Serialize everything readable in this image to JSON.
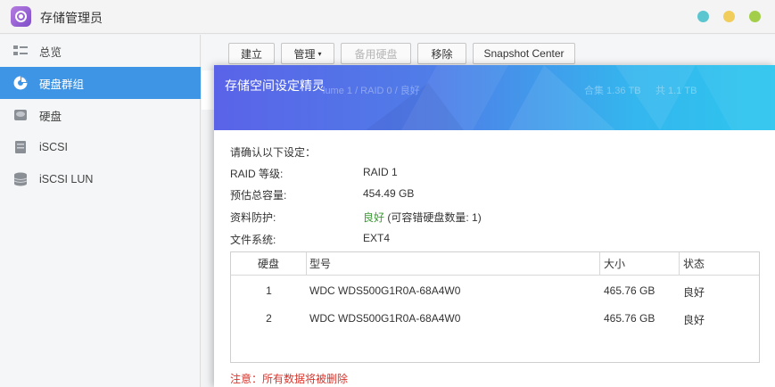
{
  "app": {
    "title": "存储管理员",
    "window_buttons": [
      {
        "name": "close",
        "color": "#5bc6cf"
      },
      {
        "name": "minimize",
        "color": "#f1cd5b"
      },
      {
        "name": "maximize",
        "color": "#a3ce4a"
      }
    ]
  },
  "sidebar": {
    "items": [
      {
        "label": "总览",
        "icon": "overview-icon"
      },
      {
        "label": "硬盘群组",
        "icon": "disk-group-icon",
        "active": true
      },
      {
        "label": "硬盘",
        "icon": "disk-icon"
      },
      {
        "label": "iSCSI",
        "icon": "iscsi-icon"
      },
      {
        "label": "iSCSI LUN",
        "icon": "iscsi-lun-icon"
      }
    ]
  },
  "toolbar": {
    "create": "建立",
    "manage": "管理",
    "manage_caret": "▾",
    "hot_spare": "备用硬盘",
    "remove": "移除",
    "snapshot": "Snapshot Center"
  },
  "background": {
    "volume_info": "lume 1 / RAID 0 / 良好",
    "size_info": "合集 1.36 TB",
    "total_info": "共 1.1 TB"
  },
  "dialog": {
    "title": "存储空间设定精灵",
    "confirm_prompt": "请确认以下设定：",
    "fields": [
      {
        "label": "RAID 等级:",
        "value": "RAID 1"
      },
      {
        "label": "预估总容量:",
        "value": "454.49 GB"
      },
      {
        "label": "资料防护:",
        "value_good": "良好",
        "value_rest": " (可容错硬盘数量: 1)"
      },
      {
        "label": "文件系统:",
        "value": "EXT4"
      }
    ],
    "table": {
      "headers": [
        "硬盘",
        "型号",
        "大小",
        "状态"
      ],
      "rows": [
        {
          "disk": "1",
          "model": "WDC WDS500G1R0A-68A4W0",
          "size": "465.76 GB",
          "status": "良好"
        },
        {
          "disk": "2",
          "model": "WDC WDS500G1R0A-68A4W0",
          "size": "465.76 GB",
          "status": "良好"
        }
      ]
    },
    "warning": "注意：所有数据将被删除"
  }
}
